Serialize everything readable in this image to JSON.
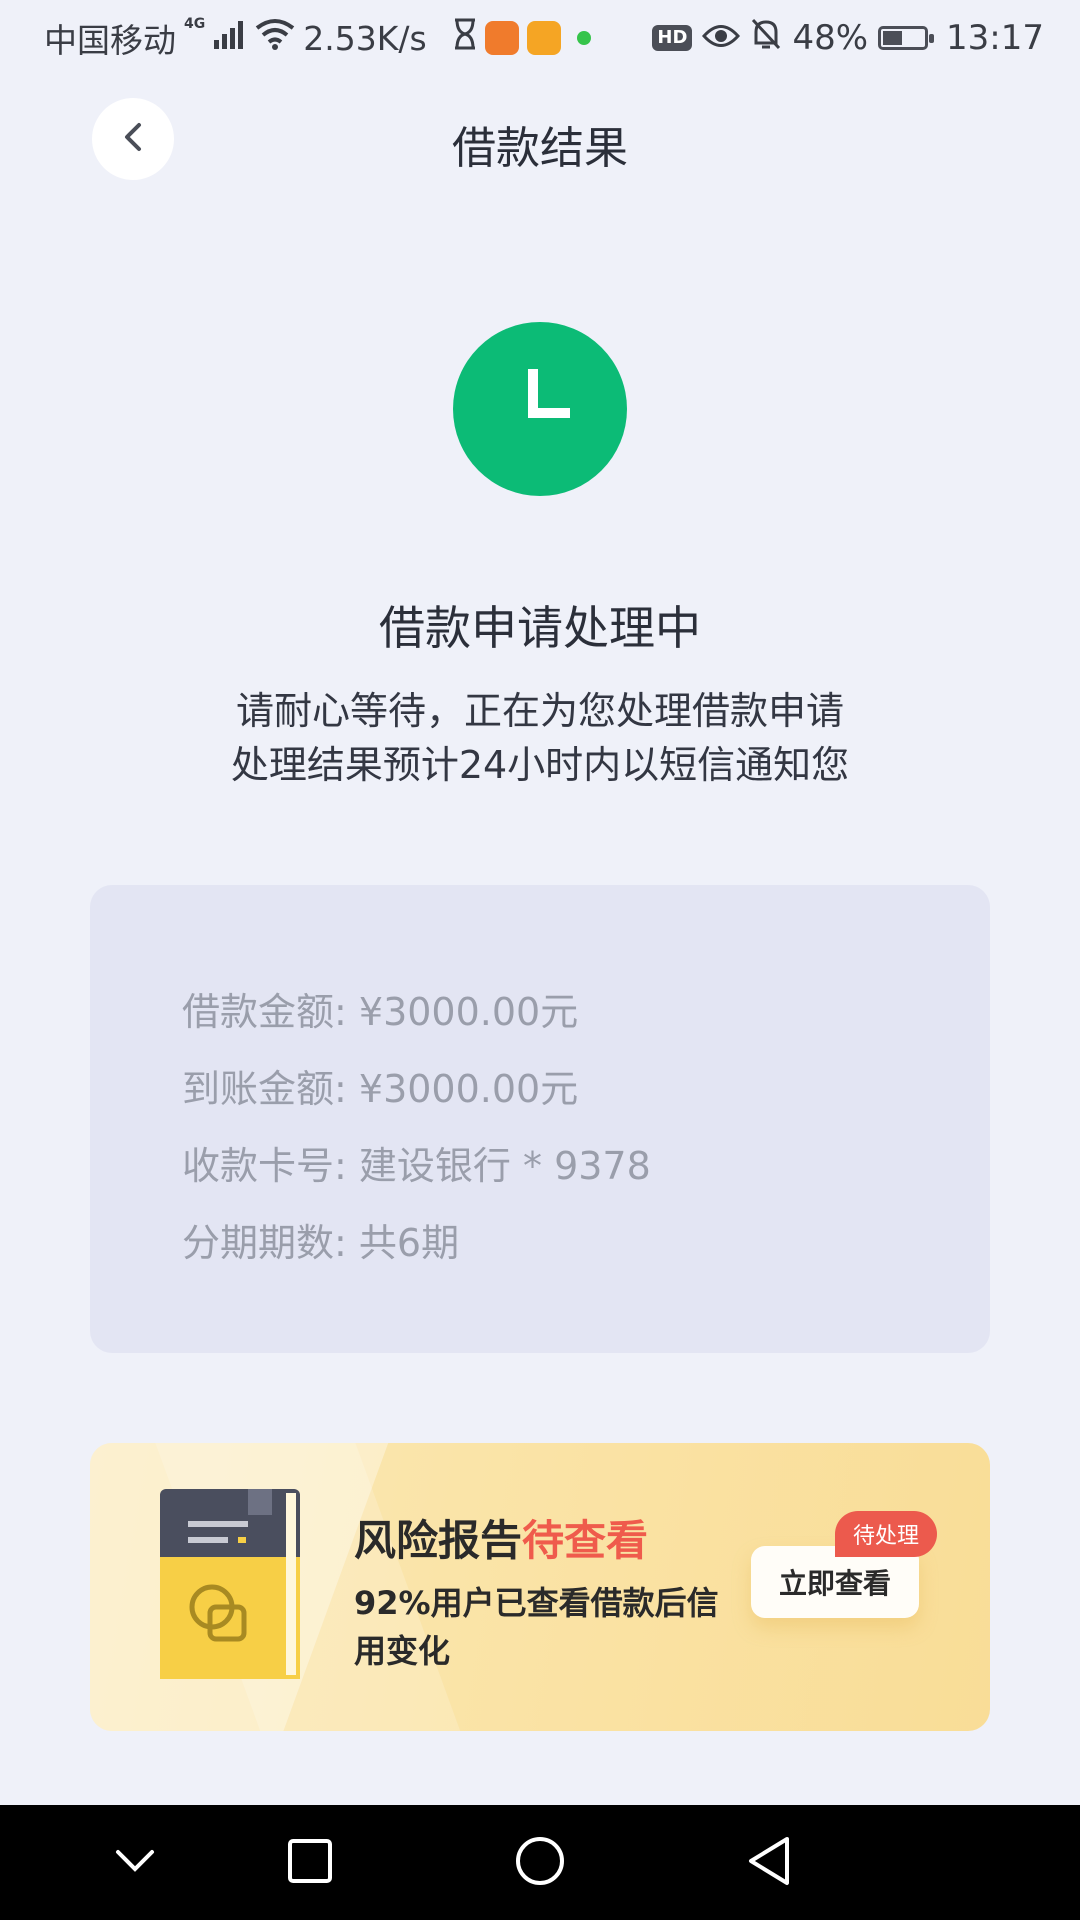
{
  "status_bar": {
    "carrier": "中国移动",
    "network_type": "4G",
    "speed": "2.53K/s",
    "hd_label": "HD",
    "battery": "48%",
    "battery_level": 0.48,
    "time": "13:17"
  },
  "header": {
    "title": "借款结果"
  },
  "status": {
    "icon_glyph": "L",
    "title": "借款申请处理中",
    "desc_line1": "请耐心等待，正在为您处理借款申请",
    "desc_line2": "处理结果预计24小时内以短信通知您"
  },
  "loan_info": {
    "rows": [
      {
        "label": "借款金额:",
        "value": "¥3000.00元"
      },
      {
        "label": "到账金额:",
        "value": "¥3000.00元"
      },
      {
        "label": "收款卡号:",
        "value": "建设银行 * 9378"
      },
      {
        "label": "分期期数:",
        "value": "共6期"
      }
    ]
  },
  "banner": {
    "title_main": "风险报告",
    "title_highlight": "待查看",
    "text": "92%用户已查看借款后信用变化",
    "button_label": "立即查看",
    "badge_label": "待处理"
  },
  "colors": {
    "accent_green": "#0cbb76",
    "highlight_red": "#ef5b4c",
    "badge_red": "#ec5a4d",
    "banner_bg": "#fae4a8",
    "card_bg": "#e3e5f3",
    "page_bg": "#eff1f9"
  },
  "icons": {
    "back": "chevron-left-icon",
    "nav_back": "triangle-back-icon",
    "nav_home": "circle-home-icon",
    "nav_recent": "square-recent-icon",
    "nav_collapse": "chevron-down-icon"
  }
}
